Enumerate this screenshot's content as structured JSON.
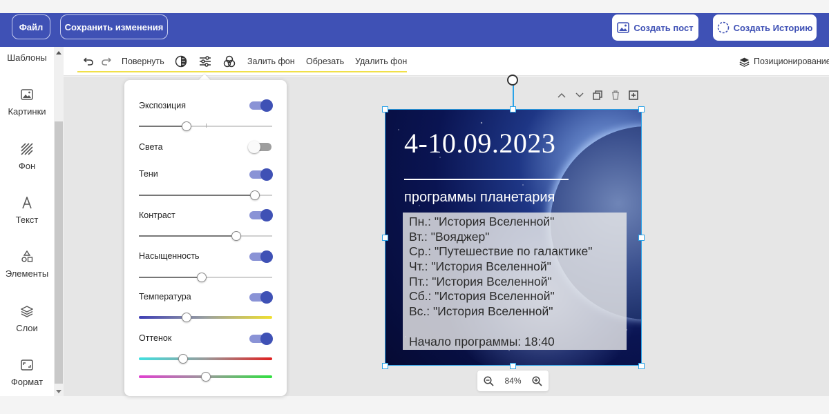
{
  "topbar": {
    "file_label": "Файл",
    "save_label": "Сохранить изменения",
    "create_post_label": "Создать пост",
    "create_story_label": "Создать Историю"
  },
  "sidebar": {
    "top_label": "Шаблоны",
    "items": [
      {
        "label": "Картинки",
        "icon": "image-icon"
      },
      {
        "label": "Фон",
        "icon": "background-pattern-icon"
      },
      {
        "label": "Текст",
        "icon": "text-icon"
      },
      {
        "label": "Элементы",
        "icon": "elements-icon"
      },
      {
        "label": "Слои",
        "icon": "layers-icon"
      },
      {
        "label": "Формат",
        "icon": "format-icon"
      }
    ]
  },
  "toolbar": {
    "rotate_label": "Повернуть",
    "fill_bg_label": "Залить фон",
    "crop_label": "Обрезать",
    "remove_bg_label": "Удалить фон",
    "positioning_label": "Позиционирование"
  },
  "adjustments": {
    "exposure": {
      "label": "Экспозиция",
      "enabled": true,
      "value": 0.36
    },
    "highlights": {
      "label": "Света",
      "enabled": false
    },
    "shadows": {
      "label": "Тени",
      "enabled": true,
      "value": 0.87
    },
    "contrast": {
      "label": "Контраст",
      "enabled": true,
      "value": 0.73
    },
    "saturation": {
      "label": "Насыщенность",
      "enabled": true,
      "value": 0.47
    },
    "temperature": {
      "label": "Температура",
      "enabled": true,
      "value": 0.36
    },
    "tint": {
      "label": "Оттенок",
      "enabled": true,
      "value_1": 0.33,
      "value_2": 0.5
    }
  },
  "design": {
    "date": "4-10.09.2023",
    "subtitle": "программы планетария",
    "schedule": [
      "Пн.: \"История Вселенной\"",
      "Вт.: \"Вояджер\"",
      "Ср.: \"Путешествие по галактике\"",
      "Чт.: \"История Вселенной\"",
      "Пт.: \"История Вселенной\"",
      "Сб.: \"История Вселенной\"",
      "Вс.: \"История Вселенной\""
    ],
    "start_time": "Начало программы: 18:40"
  },
  "zoom": {
    "level": "84%"
  },
  "colors": {
    "brand": "#3f51b5",
    "selection": "#2aa3e8",
    "highlight_underline": "#f0e04a"
  }
}
